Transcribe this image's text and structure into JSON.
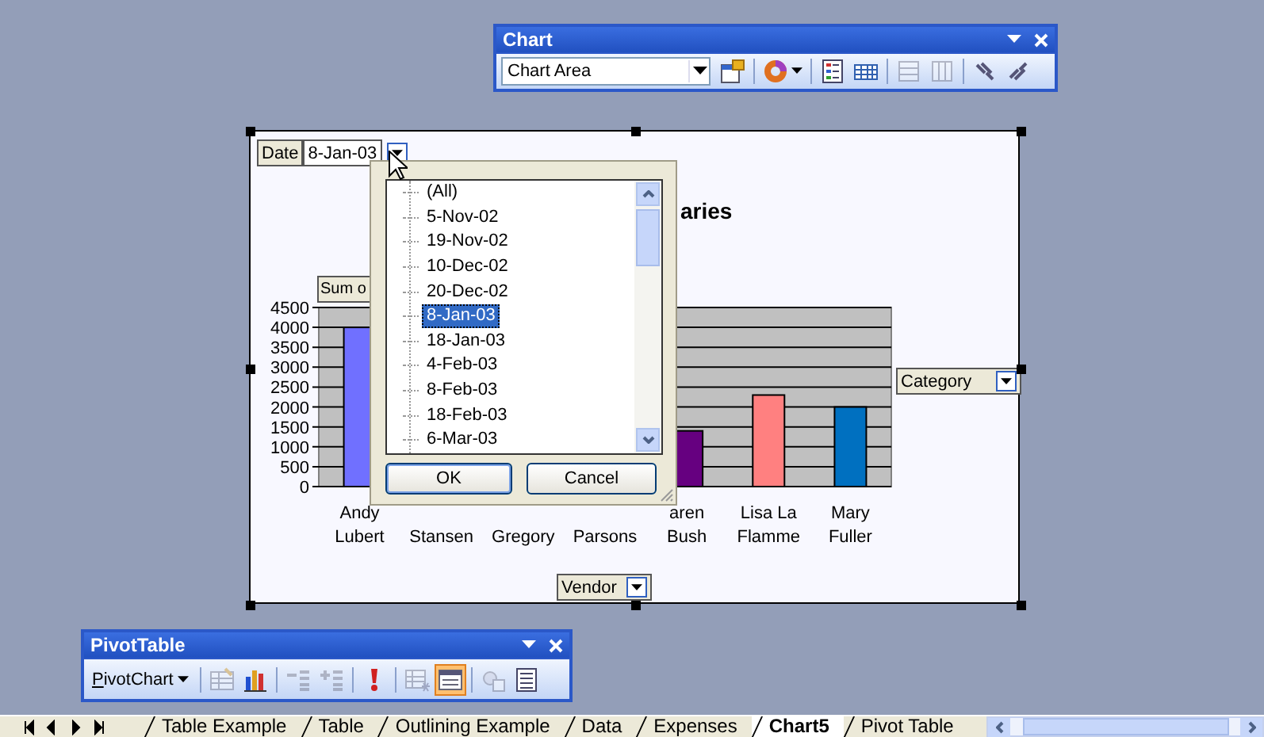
{
  "chart_toolbar": {
    "title": "Chart",
    "combo": {
      "value": "Chart Area"
    },
    "buttons": [
      {
        "kind": "format",
        "disabled": false,
        "pressed": false
      },
      {
        "kind": "separator"
      },
      {
        "kind": "chart-type",
        "disabled": false,
        "pressed": false
      },
      {
        "kind": "separator"
      },
      {
        "kind": "legend",
        "disabled": false,
        "pressed": false
      },
      {
        "kind": "data-table",
        "disabled": false,
        "pressed": false
      },
      {
        "kind": "separator"
      },
      {
        "kind": "by-row",
        "disabled": true,
        "pressed": false
      },
      {
        "kind": "by-column",
        "disabled": true,
        "pressed": false
      },
      {
        "kind": "separator"
      },
      {
        "kind": "angle-down",
        "disabled": false,
        "pressed": false
      },
      {
        "kind": "angle-up",
        "disabled": false,
        "pressed": false
      }
    ]
  },
  "chart": {
    "page_field": {
      "label": "Date",
      "value": "8-Jan-03"
    },
    "data_field": "Sum o",
    "series_field": "Category",
    "category_field": "Vendor",
    "chart_data": {
      "type": "bar",
      "title": "aries",
      "grid": true,
      "stacked": true,
      "categories": [
        "Andy\nLubert",
        "Stansen",
        "Gregory",
        "Parsons",
        "aren\nBush",
        "Lisa La\nFlamme",
        "Mary\nFuller"
      ],
      "series": [
        {
          "color": "#7070ff",
          "values": [
            4000,
            null,
            null,
            null,
            null,
            null,
            null
          ]
        },
        {
          "color": "#660080",
          "values": [
            null,
            null,
            null,
            null,
            1400,
            null,
            null
          ]
        },
        {
          "color": "#ff8080",
          "values": [
            null,
            null,
            null,
            null,
            null,
            2300,
            null
          ]
        },
        {
          "color": "#0070c0",
          "values": [
            null,
            null,
            null,
            null,
            null,
            null,
            2000
          ]
        }
      ],
      "ylim": [
        0,
        4500
      ],
      "yticks": [
        0,
        500,
        1000,
        1500,
        2000,
        2500,
        3000,
        3500,
        4000,
        4500
      ]
    }
  },
  "date_dropdown": {
    "items": [
      {
        "label": "(All)",
        "selected": false
      },
      {
        "label": "5-Nov-02",
        "selected": false
      },
      {
        "label": "19-Nov-02",
        "selected": false
      },
      {
        "label": "10-Dec-02",
        "selected": false
      },
      {
        "label": "20-Dec-02",
        "selected": false
      },
      {
        "label": "8-Jan-03",
        "selected": true
      },
      {
        "label": "18-Jan-03",
        "selected": false
      },
      {
        "label": "4-Feb-03",
        "selected": false
      },
      {
        "label": "8-Feb-03",
        "selected": false
      },
      {
        "label": "18-Feb-03",
        "selected": false
      },
      {
        "label": "6-Mar-03",
        "selected": false
      }
    ],
    "ok": "OK",
    "cancel": "Cancel"
  },
  "pivot_toolbar": {
    "title": "PivotTable",
    "menu": "PivotChart",
    "buttons": [
      {
        "kind": "separator"
      },
      {
        "kind": "format-report",
        "disabled": true,
        "pressed": false
      },
      {
        "kind": "chart-wizard",
        "disabled": false,
        "pressed": false
      },
      {
        "kind": "separator"
      },
      {
        "kind": "hide-detail",
        "disabled": true,
        "pressed": false
      },
      {
        "kind": "show-detail",
        "disabled": true,
        "pressed": false
      },
      {
        "kind": "separator"
      },
      {
        "kind": "refresh",
        "disabled": false,
        "pressed": false
      },
      {
        "kind": "separator"
      },
      {
        "kind": "include-hidden",
        "disabled": true,
        "pressed": false
      },
      {
        "kind": "field-list",
        "disabled": false,
        "pressed": true
      },
      {
        "kind": "separator"
      },
      {
        "kind": "field-settings",
        "disabled": true,
        "pressed": false
      },
      {
        "kind": "table-options",
        "disabled": false,
        "pressed": false
      }
    ]
  },
  "sheet_tabs": [
    {
      "label": "Table Example",
      "selected": false
    },
    {
      "label": "Table",
      "selected": false
    },
    {
      "label": "Outlining Example",
      "selected": false
    },
    {
      "label": "Data",
      "selected": false
    },
    {
      "label": "Expenses",
      "selected": false
    },
    {
      "label": "Chart5",
      "selected": true
    },
    {
      "label": "Pivot Table",
      "selected": false
    }
  ]
}
